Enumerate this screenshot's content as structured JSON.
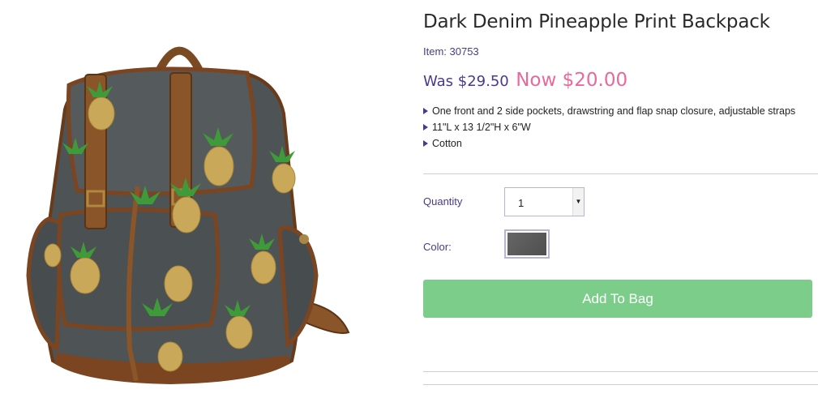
{
  "product": {
    "title": "Dark Denim Pineapple Print Backpack",
    "item_label": "Item: 30753",
    "was_price": "Was $29.50",
    "now_price": "Now $20.00",
    "image_alt": "Dark denim pineapple print backpack",
    "features": [
      "One front and 2 side pockets, drawstring and flap snap closure, adjustable straps",
      "11\"L x 13 1/2\"H x 6\"W",
      "Cotton"
    ]
  },
  "options": {
    "quantity_label": "Quantity",
    "quantity_value": "1",
    "color_label": "Color:",
    "color_swatch": "#5c5c5c"
  },
  "actions": {
    "add_to_bag": "Add To Bag"
  },
  "colors": {
    "brand_purple": "#4a3a8a",
    "sale_pink": "#e8699a",
    "button_green": "#7ccd8a"
  }
}
